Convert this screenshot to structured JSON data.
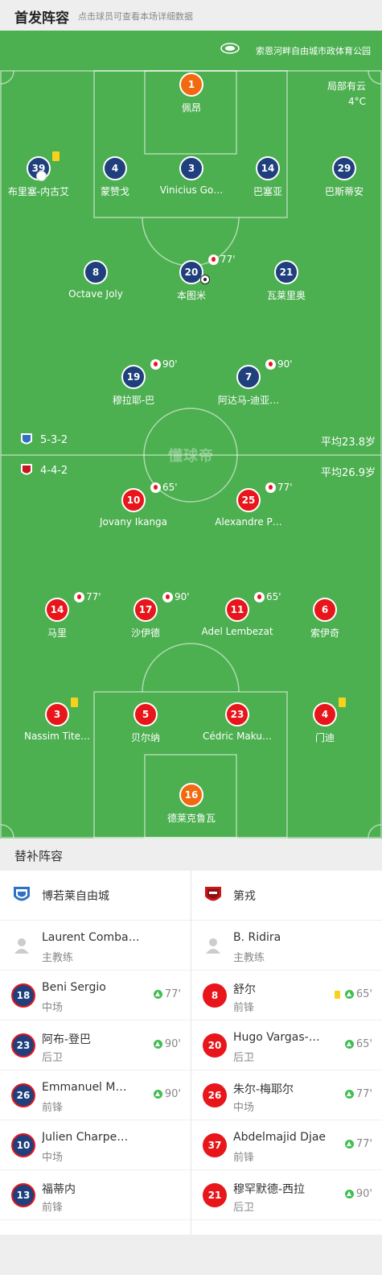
{
  "header": {
    "title": "首发阵容",
    "subtitle": "点击球员可查看本场详细数据"
  },
  "venue": {
    "name": "索恩河畔自由城市政体育公园"
  },
  "weather": {
    "condition": "局部有云",
    "temp": "4°C"
  },
  "watermark": "懂球帝",
  "home": {
    "formation": "5-3-2",
    "avg_age": "平均23.8岁",
    "color": "#1f3f7d",
    "players": [
      {
        "num": "1",
        "name": "佩昂",
        "row": 0,
        "col": 0.5,
        "gk": true
      },
      {
        "num": "39",
        "name": "布里塞-内古艾",
        "row": 1,
        "col": 0.1,
        "yellow": true,
        "boot": true
      },
      {
        "num": "4",
        "name": "蒙赞戈",
        "row": 1,
        "col": 0.3
      },
      {
        "num": "3",
        "name": "Vinicius Go…",
        "row": 1,
        "col": 0.5
      },
      {
        "num": "14",
        "name": "巴塞亚",
        "row": 1,
        "col": 0.7
      },
      {
        "num": "29",
        "name": "巴斯蒂安",
        "row": 1,
        "col": 0.9
      },
      {
        "num": "8",
        "name": "Octave Joly",
        "row": 2,
        "col": 0.25
      },
      {
        "num": "20",
        "name": "本图米",
        "row": 2,
        "col": 0.5,
        "sub": "77'",
        "goal": true
      },
      {
        "num": "21",
        "name": "瓦莱里奥",
        "row": 2,
        "col": 0.75
      },
      {
        "num": "19",
        "name": "穆拉耶-巴",
        "row": 3,
        "col": 0.35,
        "sub": "90'"
      },
      {
        "num": "7",
        "name": "阿达马-迪亚…",
        "row": 3,
        "col": 0.65,
        "sub": "90'"
      }
    ]
  },
  "away": {
    "formation": "4-4-2",
    "avg_age": "平均26.9岁",
    "color": "#e8161b",
    "players": [
      {
        "num": "10",
        "name": "Jovany Ikanga",
        "row": 3,
        "col": 0.35,
        "sub": "65'"
      },
      {
        "num": "25",
        "name": "Alexandre P…",
        "row": 3,
        "col": 0.65,
        "sub": "77'"
      },
      {
        "num": "14",
        "name": "马里",
        "row": 2,
        "col": 0.15,
        "sub": "77'"
      },
      {
        "num": "17",
        "name": "沙伊德",
        "row": 2,
        "col": 0.38,
        "sub": "90'"
      },
      {
        "num": "11",
        "name": "Adel Lembezat",
        "row": 2,
        "col": 0.62,
        "sub": "65'"
      },
      {
        "num": "6",
        "name": "索伊奇",
        "row": 2,
        "col": 0.85
      },
      {
        "num": "3",
        "name": "Nassim Tite…",
        "row": 1,
        "col": 0.15,
        "yellow": true
      },
      {
        "num": "5",
        "name": "贝尔纳",
        "row": 1,
        "col": 0.38
      },
      {
        "num": "23",
        "name": "Cédric Maku…",
        "row": 1,
        "col": 0.62
      },
      {
        "num": "4",
        "name": "门迪",
        "row": 1,
        "col": 0.85,
        "yellow": true
      },
      {
        "num": "16",
        "name": "德莱克鲁瓦",
        "row": 0,
        "col": 0.5,
        "gk": true
      }
    ]
  },
  "subs_section": {
    "title": "替补阵容"
  },
  "subs": {
    "home_team": "博若莱自由城",
    "away_team": "第戎",
    "home_coach": {
      "name": "Laurent Combarel",
      "role": "主教练"
    },
    "away_coach": {
      "name": "B. Ridira",
      "role": "主教练"
    },
    "home": [
      {
        "num": "18",
        "name": "Beni Sergio",
        "pos": "中场",
        "minute": "77'"
      },
      {
        "num": "23",
        "name": "阿布-登巴",
        "pos": "后卫",
        "minute": "90'"
      },
      {
        "num": "26",
        "name": "Emmanuel M…",
        "pos": "前锋",
        "minute": "90'"
      },
      {
        "num": "10",
        "name": "Julien Charpe…",
        "pos": "中场",
        "minute": ""
      },
      {
        "num": "13",
        "name": "福蒂内",
        "pos": "前锋",
        "minute": ""
      }
    ],
    "away": [
      {
        "num": "8",
        "name": "舒尔",
        "pos": "前锋",
        "minute": "65'",
        "yellow": true
      },
      {
        "num": "20",
        "name": "Hugo Vargas-…",
        "pos": "后卫",
        "minute": "65'"
      },
      {
        "num": "26",
        "name": "朱尔-梅耶尔",
        "pos": "中场",
        "minute": "77'"
      },
      {
        "num": "37",
        "name": "Abdelmajid Djae",
        "pos": "前锋",
        "minute": "77'"
      },
      {
        "num": "21",
        "name": "穆罕默德-西拉",
        "pos": "后卫",
        "minute": "90'"
      }
    ]
  }
}
